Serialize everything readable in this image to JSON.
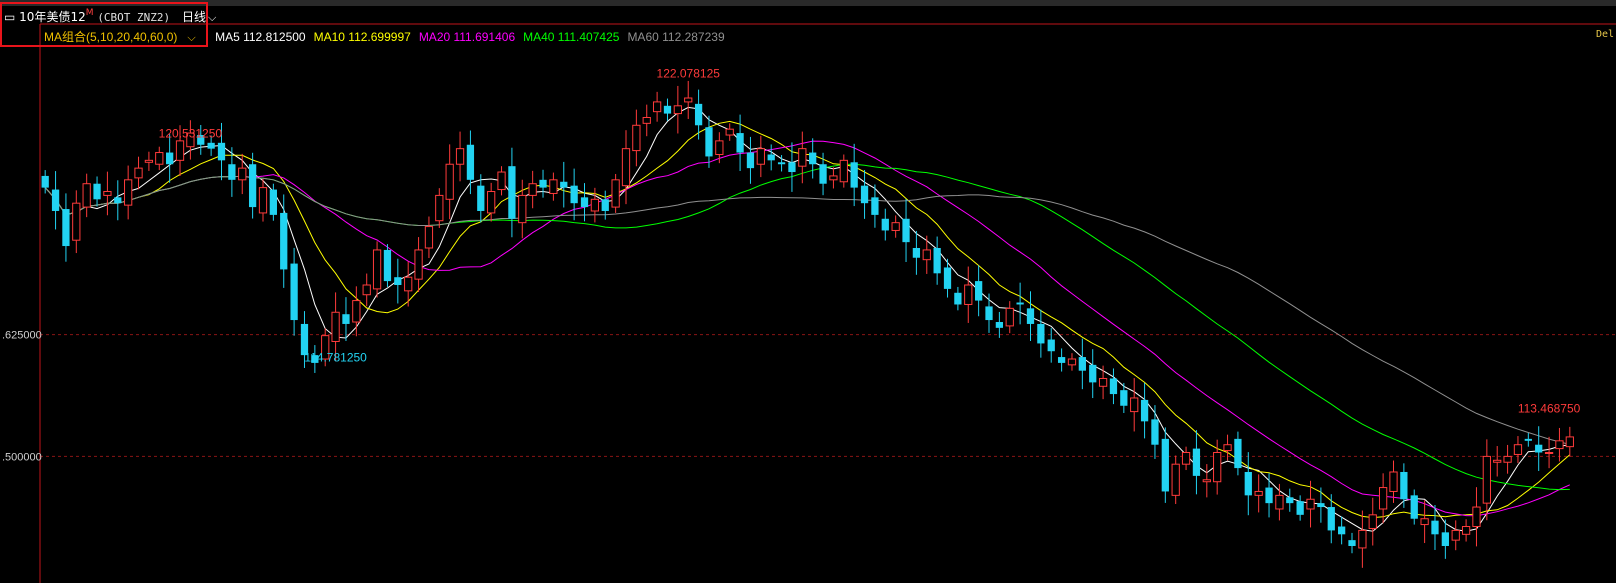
{
  "header": {
    "title_cn": "10年美债12",
    "title_sup": "M",
    "code": "(CBOT ZNZ2)",
    "period": "日线",
    "ma_group_label": "MA组合(5,10,20,40,60,0)",
    "corner_label": "Del"
  },
  "ma_legend": [
    {
      "label": "MA5 112.812500",
      "color": "#ffffff"
    },
    {
      "label": "MA10 112.699997",
      "color": "#ffff00"
    },
    {
      "label": "MA20 111.691406",
      "color": "#ff00ff"
    },
    {
      "label": "MA40 111.407425",
      "color": "#00ff00"
    },
    {
      "label": "MA60 112.287239",
      "color": "#909090"
    }
  ],
  "chart_data": {
    "type": "candlestick",
    "y_ticks": [
      {
        "value": 115.625,
        "label": ".625000"
      },
      {
        "value": 112.5,
        "label": ".500000"
      }
    ],
    "annotations": [
      {
        "text": "120.531250",
        "x": 14,
        "y": 120.53125,
        "color": "#ff3b3b"
      },
      {
        "text": "114.781250",
        "x": 28,
        "y": 114.78125,
        "color": "#22d3f2"
      },
      {
        "text": "122.078125",
        "x": 62,
        "y": 122.078125,
        "color": "#ff3b3b"
      },
      {
        "text": "113.468750",
        "x": 145,
        "y": 113.46875,
        "color": "#ff3b3b"
      }
    ],
    "up_color": "#ff3b3b",
    "down_color": "#22d3f2",
    "ylim": [
      109.25,
      123.6
    ],
    "closes": [
      119.4,
      118.8,
      117.9,
      119.0,
      119.5,
      119.1,
      119.3,
      119.0,
      119.6,
      119.9,
      120.1,
      120.3,
      120.0,
      120.6,
      120.8,
      120.5,
      120.4,
      120.1,
      119.6,
      119.9,
      118.9,
      119.4,
      118.7,
      117.3,
      116.0,
      115.1,
      114.9,
      115.6,
      116.2,
      115.9,
      116.5,
      116.9,
      117.8,
      117.0,
      116.9,
      117.1,
      117.8,
      118.4,
      119.2,
      120.0,
      120.4,
      119.6,
      118.8,
      119.3,
      119.8,
      118.6,
      119.2,
      119.5,
      119.4,
      119.6,
      119.4,
      119.0,
      118.9,
      119.1,
      118.8,
      119.6,
      120.4,
      121.0,
      121.2,
      121.6,
      121.3,
      121.5,
      121.7,
      121.0,
      120.2,
      120.6,
      120.9,
      120.3,
      119.9,
      120.4,
      120.1,
      120.0,
      119.8,
      120.4,
      120.0,
      119.5,
      119.7,
      120.1,
      119.4,
      119.0,
      118.7,
      118.3,
      118.5,
      118.0,
      117.6,
      117.8,
      117.2,
      116.8,
      116.4,
      116.9,
      116.5,
      116.0,
      115.8,
      116.3,
      116.4,
      115.9,
      115.4,
      115.2,
      114.9,
      115.0,
      114.7,
      114.4,
      114.5,
      114.1,
      113.8,
      114.0,
      113.4,
      112.8,
      111.6,
      112.3,
      112.6,
      112.0,
      111.9,
      112.6,
      112.8,
      112.2,
      111.5,
      111.6,
      111.3,
      111.5,
      111.3,
      111.0,
      111.4,
      111.2,
      110.6,
      110.5,
      110.2,
      110.6,
      111.0,
      111.7,
      112.1,
      111.4,
      110.9,
      110.9,
      110.5,
      110.2,
      110.6,
      110.7,
      111.2,
      112.5,
      112.4,
      112.5,
      112.8,
      112.9,
      112.6,
      112.6,
      112.9,
      113.0
    ],
    "series": [
      {
        "name": "MA5",
        "color": "#ffffff"
      },
      {
        "name": "MA10",
        "color": "#ffff00"
      },
      {
        "name": "MA20",
        "color": "#ff00ff"
      },
      {
        "name": "MA40",
        "color": "#00ff00"
      },
      {
        "name": "MA60",
        "color": "#909090"
      }
    ],
    "ma_periods": [
      5,
      10,
      20,
      40,
      60
    ]
  }
}
